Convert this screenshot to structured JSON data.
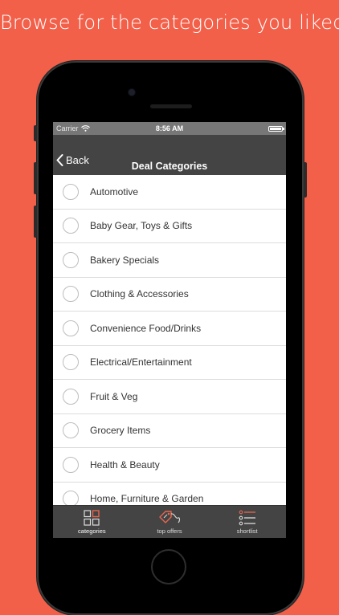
{
  "headline": "Browse for the categories you liked",
  "status_bar": {
    "carrier": "Carrier",
    "time": "8:56 AM"
  },
  "nav": {
    "back_label": "Back",
    "title": "Deal Categories"
  },
  "categories": [
    {
      "label": "Automotive"
    },
    {
      "label": "Baby Gear, Toys & Gifts"
    },
    {
      "label": "Bakery Specials"
    },
    {
      "label": "Clothing & Accessories"
    },
    {
      "label": "Convenience Food/Drinks"
    },
    {
      "label": "Electrical/Entertainment"
    },
    {
      "label": "Fruit & Veg"
    },
    {
      "label": "Grocery Items"
    },
    {
      "label": "Health & Beauty"
    },
    {
      "label": "Home, Furniture & Garden"
    }
  ],
  "tabs": [
    {
      "label": "categories",
      "icon": "grid-icon"
    },
    {
      "label": "top offers",
      "icon": "tag-icon"
    },
    {
      "label": "shortlist",
      "icon": "list-icon"
    }
  ],
  "colors": {
    "background": "#f2604a",
    "bar": "#444444",
    "accent": "#e8664f"
  }
}
